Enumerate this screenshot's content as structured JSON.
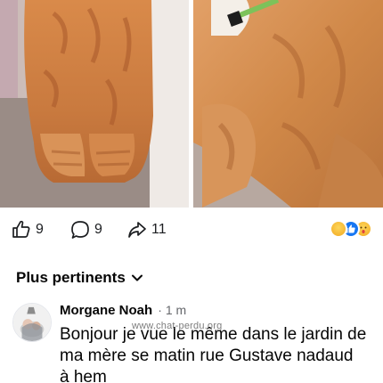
{
  "post": {
    "images": [
      {
        "alt": "orange-cat-sitting-paws"
      },
      {
        "alt": "orange-cat-closeup-green-collar"
      }
    ]
  },
  "actions": {
    "like_count": "9",
    "comment_count": "9",
    "share_count": "11",
    "reactions": [
      "haha",
      "like",
      "wow"
    ]
  },
  "comments_sort": {
    "label": "Plus pertinents"
  },
  "comment": {
    "author": "Morgane Noah",
    "separator": "·",
    "time": "1 m",
    "text": "Bonjour je vue le même dans le jardin de ma mère se matin rue Gustave nadaud à hem"
  },
  "watermark": "www.chat-perdu.org",
  "colors": {
    "text": "#050505",
    "secondary": "#65676b",
    "like_blue": "#1877f2",
    "reaction_yellow": "#f7b928"
  }
}
